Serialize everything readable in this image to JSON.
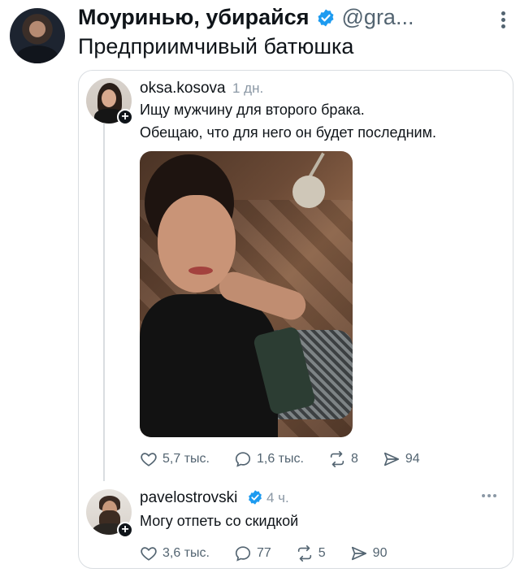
{
  "header": {
    "author_name": "Моуринью, убирайся",
    "handle": "@gra...",
    "text": "Предприимчивый батюшка"
  },
  "quoted_post": {
    "username": "oksa.kosova",
    "time": "1 дн.",
    "line1": "Ищу мужчину для второго брака.",
    "line2": "Обещаю, что для него он будет последним.",
    "stats": {
      "likes": "5,7 тыс.",
      "replies": "1,6 тыс.",
      "reposts": "8",
      "shares": "94"
    }
  },
  "reply_post": {
    "username": "pavelostrovski",
    "time": "4 ч.",
    "text": "Могу отпеть со скидкой",
    "stats": {
      "likes": "3,6 тыс.",
      "replies": "77",
      "reposts": "5",
      "shares": "90"
    }
  },
  "icons": {
    "verified": "verified-badge-icon",
    "like": "heart-icon",
    "reply": "comment-bubble-icon",
    "repost": "repost-icon",
    "share": "send-icon"
  },
  "colors": {
    "verified_blue": "#1d9bf0",
    "text_primary": "#0f1419",
    "text_secondary": "#536471"
  }
}
